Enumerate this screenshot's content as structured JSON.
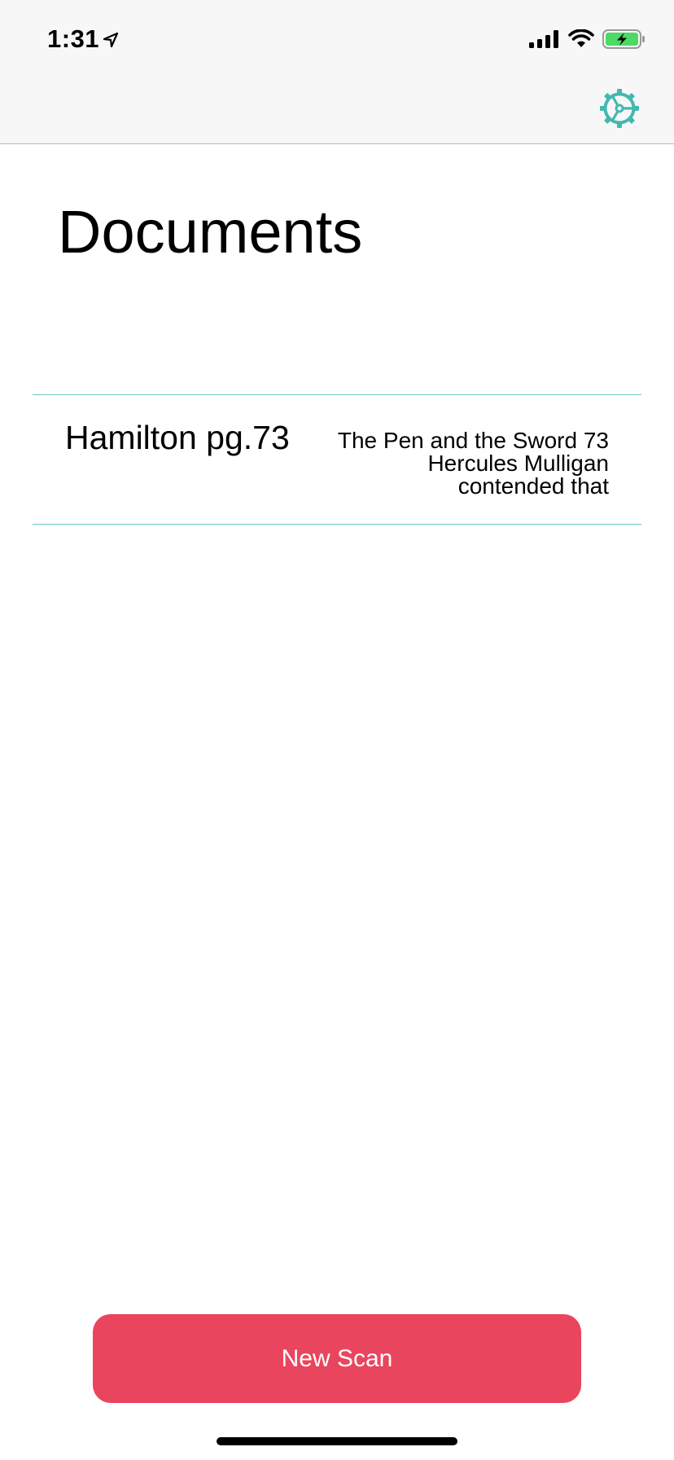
{
  "status_bar": {
    "time": "1:31",
    "icons": [
      "location-arrow-icon",
      "signal-icon",
      "wifi-icon",
      "battery-charging-icon"
    ]
  },
  "header": {
    "settings_icon": "gear-icon",
    "accent_color": "#42b8b0"
  },
  "main": {
    "title": "Documents",
    "documents": [
      {
        "name": "Hamilton pg.73",
        "preview": "The Pen and the Sword 73 Hercules Mulligan contended that"
      }
    ]
  },
  "footer": {
    "new_scan_label": "New Scan",
    "button_color": "#ea455e"
  }
}
